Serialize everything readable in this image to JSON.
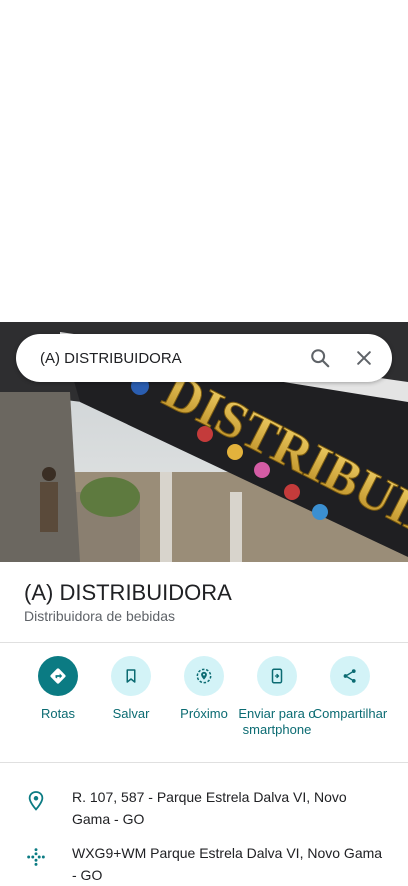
{
  "search": {
    "query": "(A) DISTRIBUIDORA"
  },
  "photo": {
    "sign_text": "DISTRIBUIDORA"
  },
  "place": {
    "name": "(A) DISTRIBUIDORA",
    "category": "Distribuidora de bebidas"
  },
  "actions": [
    {
      "label": "Rotas",
      "icon": "directions-icon"
    },
    {
      "label": "Salvar",
      "icon": "bookmark-icon"
    },
    {
      "label": "Próximo",
      "icon": "nearby-icon"
    },
    {
      "label": "Enviar para o smartphone",
      "icon": "send-to-phone-icon"
    },
    {
      "label": "Compartilhar",
      "icon": "share-icon"
    }
  ],
  "details": {
    "address": "R. 107, 587 - Parque Estrela Dalva VI, Novo Gama - GO",
    "plus_code": "WXG9+WM Parque Estrela Dalva VI, Novo Gama - GO"
  },
  "colors": {
    "accent": "#0b7b83",
    "accent_light": "#d3f3f7"
  }
}
